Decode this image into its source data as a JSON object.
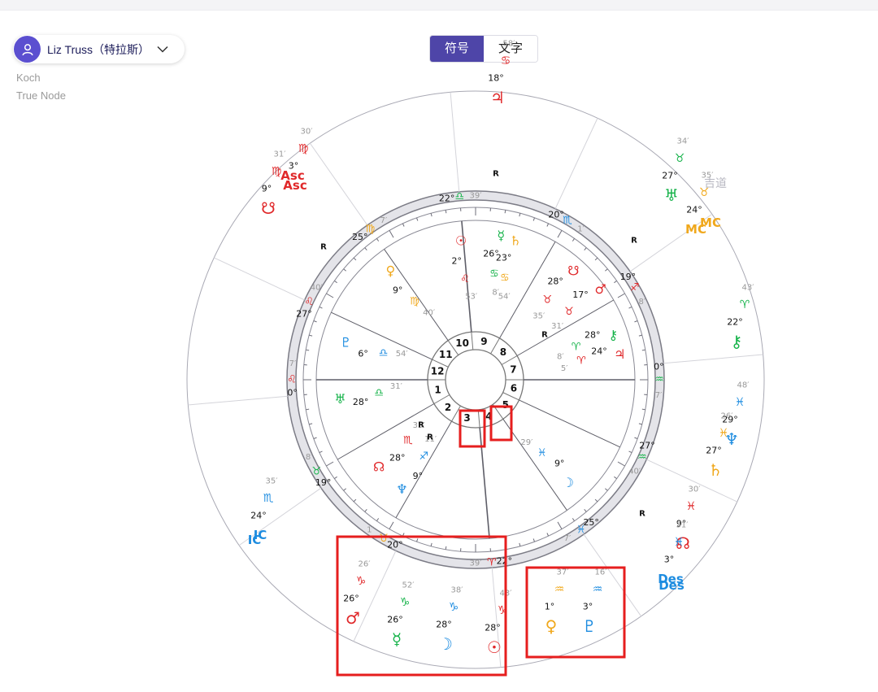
{
  "header": {
    "person_name": "Liz Truss（特拉斯）",
    "house_system": "Koch",
    "node_type": "True Node",
    "tabs": [
      "符号",
      "文字"
    ],
    "active_tab": "符号"
  },
  "colors": {
    "accent": "#4e45a8",
    "fire": "#e0282a",
    "earth": "#f0a81c",
    "air": "#16b34a",
    "water": "#1d8ce0",
    "highlight": "#e61e1e"
  },
  "chart": {
    "annotation": "吉道",
    "houses": [
      "1",
      "2",
      "3",
      "4",
      "5",
      "6",
      "7",
      "8",
      "9",
      "10",
      "11",
      "12"
    ],
    "angles": [
      "Asc",
      "MC",
      "Des",
      "IC"
    ],
    "retrograde": "R",
    "cusps": [
      {
        "deg": "0°",
        "sign": "♌",
        "min": "7′",
        "color": "fire"
      },
      {
        "deg": "19°",
        "sign": "♉",
        "min": "8′",
        "color": "air"
      },
      {
        "deg": "20°",
        "sign": "♉",
        "min": "1′",
        "color": "earth"
      },
      {
        "deg": "22°",
        "sign": "♈",
        "min": "39′",
        "color": "fire"
      },
      {
        "deg": "25°",
        "sign": "♓",
        "min": "7′",
        "color": "water"
      },
      {
        "deg": "27°",
        "sign": "♒",
        "min": "40′",
        "color": "air"
      },
      {
        "deg": "0°",
        "sign": "♒",
        "min": "7′",
        "color": "air"
      },
      {
        "deg": "19°",
        "sign": "♐",
        "min": "8′",
        "color": "fire"
      },
      {
        "deg": "20°",
        "sign": "♏",
        "min": "1′",
        "color": "water"
      },
      {
        "deg": "22°",
        "sign": "♎",
        "min": "39′",
        "color": "air"
      },
      {
        "deg": "25°",
        "sign": "♍",
        "min": "7′",
        "color": "earth"
      },
      {
        "deg": "27°",
        "sign": "♌",
        "min": "40′",
        "color": "fire"
      }
    ],
    "inner_planets": [
      {
        "glyph": "☉",
        "deg": "2°",
        "sign": "♌",
        "min": "53′",
        "color": "fire"
      },
      {
        "glyph": "☿",
        "deg": "26°",
        "sign": "♋",
        "min": "8′",
        "color": "air"
      },
      {
        "glyph": "♄",
        "deg": "23°",
        "sign": "♋",
        "min": "54′",
        "color": "earth"
      },
      {
        "glyph": "♀",
        "deg": "9°",
        "sign": "♍",
        "min": "40′",
        "color": "earth"
      },
      {
        "glyph": "☋",
        "deg": "28°",
        "sign": "♉",
        "min": "35′",
        "color": "fire"
      },
      {
        "glyph": "♂",
        "deg": "17°",
        "sign": "♉",
        "min": "31′",
        "color": "fire"
      },
      {
        "glyph": "⚷",
        "deg": "28°",
        "sign": "♈",
        "min": "8′",
        "color": "air"
      },
      {
        "glyph": "♃",
        "deg": "24°",
        "sign": "♈",
        "min": "5′",
        "color": "fire"
      },
      {
        "glyph": "♇",
        "deg": "6°",
        "sign": "♎",
        "min": "54′",
        "color": "water"
      },
      {
        "glyph": "♅",
        "deg": "28°",
        "sign": "♎",
        "min": "31′",
        "color": "air"
      },
      {
        "glyph": "☊",
        "deg": "28°",
        "sign": "♏",
        "min": "35′",
        "color": "fire"
      },
      {
        "glyph": "♆",
        "deg": "9°",
        "sign": "♐",
        "min": "11′",
        "color": "water"
      },
      {
        "glyph": "☽",
        "deg": "9°",
        "sign": "♓",
        "min": "29′",
        "color": "water"
      }
    ],
    "outer_labels": [
      {
        "glyph": "♃",
        "deg": "18°",
        "sign": "♋",
        "min": "58′",
        "color": "fire"
      },
      {
        "glyph": "♅",
        "deg": "27°",
        "sign": "♉",
        "min": "34′",
        "color": "air"
      },
      {
        "glyph": "MC",
        "deg": "24°",
        "sign": "♉",
        "min": "35′",
        "color": "earth"
      },
      {
        "glyph": "⚷",
        "deg": "22°",
        "sign": "♈",
        "min": "43′",
        "color": "air"
      },
      {
        "glyph": "♆",
        "deg": "29°",
        "sign": "♓",
        "min": "48′",
        "color": "water"
      },
      {
        "glyph": "♄",
        "deg": "27°",
        "sign": "♓",
        "min": "26′",
        "color": "earth"
      },
      {
        "glyph": "☊",
        "deg": "9°",
        "sign": "♓",
        "min": "30′",
        "color": "fire"
      },
      {
        "glyph": "Des",
        "deg": "3°",
        "sign": "♓",
        "min": "31′",
        "color": "water"
      },
      {
        "glyph": "♇",
        "deg": "3°",
        "sign": "♒",
        "min": "16′",
        "color": "water"
      },
      {
        "glyph": "♀",
        "deg": "1°",
        "sign": "♒",
        "min": "37′",
        "color": "earth"
      },
      {
        "glyph": "☉",
        "deg": "28°",
        "sign": "♑",
        "min": "43′",
        "color": "fire"
      },
      {
        "glyph": "☽",
        "deg": "28°",
        "sign": "♑",
        "min": "38′",
        "color": "water"
      },
      {
        "glyph": "☿",
        "deg": "26°",
        "sign": "♑",
        "min": "52′",
        "color": "air"
      },
      {
        "glyph": "♂",
        "deg": "26°",
        "sign": "♑",
        "min": "26′",
        "color": "fire"
      },
      {
        "glyph": "IC",
        "deg": "24°",
        "sign": "♏",
        "min": "35′",
        "color": "water"
      },
      {
        "glyph": "Asc",
        "deg": "3°",
        "sign": "♍",
        "min": "30′",
        "color": "fire"
      },
      {
        "glyph": "☋",
        "deg": "9°",
        "sign": "♍",
        "min": "31′",
        "color": "fire"
      }
    ]
  }
}
